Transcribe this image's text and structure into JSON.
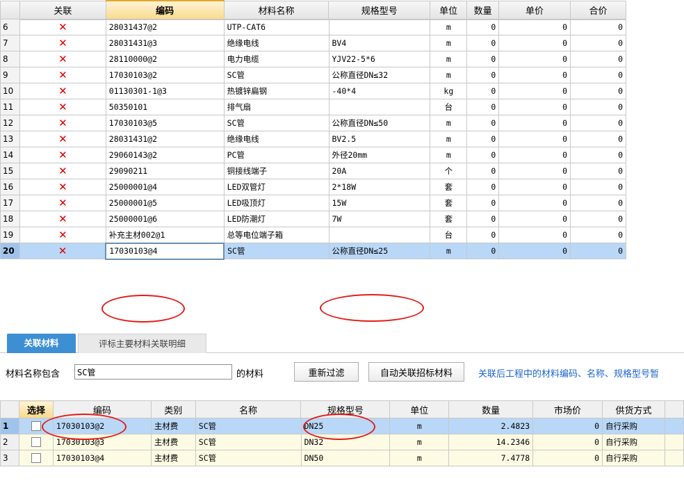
{
  "top_table": {
    "headers": [
      "关联",
      "编码",
      "材料名称",
      "规格型号",
      "单位",
      "数量",
      "单价",
      "合价"
    ],
    "rows": [
      {
        "no": "6",
        "x": "✕",
        "code": "28031437@2",
        "name": "UTP-CAT6",
        "spec": "",
        "unit": "m",
        "qty": "0",
        "price": "0",
        "total": "0"
      },
      {
        "no": "7",
        "x": "✕",
        "code": "28031431@3",
        "name": "绝缘电线",
        "spec": "BV4",
        "unit": "m",
        "qty": "0",
        "price": "0",
        "total": "0"
      },
      {
        "no": "8",
        "x": "✕",
        "code": "28110000@2",
        "name": "电力电缆",
        "spec": "YJV22-5*6",
        "unit": "m",
        "qty": "0",
        "price": "0",
        "total": "0"
      },
      {
        "no": "9",
        "x": "✕",
        "code": "17030103@2",
        "name": "SC管",
        "spec": "公称直径DN≤32",
        "unit": "m",
        "qty": "0",
        "price": "0",
        "total": "0"
      },
      {
        "no": "10",
        "x": "✕",
        "code": "01130301-1@3",
        "name": "热镀锌扁钢",
        "spec": "-40*4",
        "unit": "kg",
        "qty": "0",
        "price": "0",
        "total": "0"
      },
      {
        "no": "11",
        "x": "✕",
        "code": "50350101",
        "name": "排气扇",
        "spec": "",
        "unit": "台",
        "qty": "0",
        "price": "0",
        "total": "0"
      },
      {
        "no": "12",
        "x": "✕",
        "code": "17030103@5",
        "name": "SC管",
        "spec": "公称直径DN≤50",
        "unit": "m",
        "qty": "0",
        "price": "0",
        "total": "0"
      },
      {
        "no": "13",
        "x": "✕",
        "code": "28031431@2",
        "name": "绝缘电线",
        "spec": "BV2.5",
        "unit": "m",
        "qty": "0",
        "price": "0",
        "total": "0"
      },
      {
        "no": "14",
        "x": "✕",
        "code": "29060143@2",
        "name": "PC管",
        "spec": "外径20mm",
        "unit": "m",
        "qty": "0",
        "price": "0",
        "total": "0"
      },
      {
        "no": "15",
        "x": "✕",
        "code": "29090211",
        "name": "铜接线端子",
        "spec": "20A",
        "unit": "个",
        "qty": "0",
        "price": "0",
        "total": "0"
      },
      {
        "no": "16",
        "x": "✕",
        "code": "25000001@4",
        "name": "LED双管灯",
        "spec": "2*18W",
        "unit": "套",
        "qty": "0",
        "price": "0",
        "total": "0"
      },
      {
        "no": "17",
        "x": "✕",
        "code": "25000001@5",
        "name": "LED吸顶灯",
        "spec": "15W",
        "unit": "套",
        "qty": "0",
        "price": "0",
        "total": "0"
      },
      {
        "no": "18",
        "x": "✕",
        "code": "25000001@6",
        "name": "LED防潮灯",
        "spec": "7W",
        "unit": "套",
        "qty": "0",
        "price": "0",
        "total": "0"
      },
      {
        "no": "19",
        "x": "✕",
        "code": "补充主材002@1",
        "name": "总等电位端子箱",
        "spec": "",
        "unit": "台",
        "qty": "0",
        "price": "0",
        "total": "0"
      },
      {
        "no": "20",
        "x": "✕",
        "code": "17030103@4",
        "name": "SC管",
        "spec": "公称直径DN≤25",
        "unit": "m",
        "qty": "0",
        "price": "0",
        "total": "0"
      }
    ]
  },
  "tabs": {
    "active": "关联材料",
    "inactive": "评标主要材料关联明细"
  },
  "filter": {
    "label": "材料名称包含",
    "value": "SC管",
    "suffix": "的材料",
    "refilter_button": "重新过滤",
    "auto_button": "自动关联招标材料",
    "notice": "关联后工程中的材料编码、名称、规格型号暂"
  },
  "bottom_table": {
    "headers": [
      "选择",
      "编码",
      "类别",
      "名称",
      "规格型号",
      "单位",
      "数量",
      "市场价",
      "供货方式"
    ],
    "rows": [
      {
        "no": "1",
        "code": "17030103@2",
        "cat": "主材费",
        "name": "SC管",
        "spec": "DN25",
        "unit": "m",
        "qty": "2.4823",
        "price": "0",
        "supply": "自行采购"
      },
      {
        "no": "2",
        "code": "17030103@3",
        "cat": "主材费",
        "name": "SC管",
        "spec": "DN32",
        "unit": "m",
        "qty": "14.2346",
        "price": "0",
        "supply": "自行采购"
      },
      {
        "no": "3",
        "code": "17030103@4",
        "cat": "主材费",
        "name": "SC管",
        "spec": "DN50",
        "unit": "m",
        "qty": "7.4778",
        "price": "0",
        "supply": "自行采购"
      }
    ]
  },
  "colors": {
    "selected_row": "#b9d7f7",
    "x_mark": "#e00000",
    "annotation": "#e41b17",
    "tab_active": "#3d8fd4",
    "notice_text": "#1c64d1"
  }
}
